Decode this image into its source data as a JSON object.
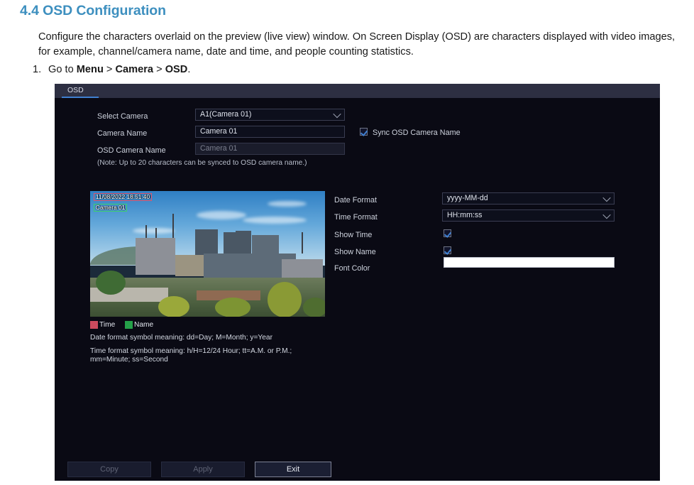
{
  "document": {
    "heading": "4.4 OSD Configuration",
    "paragraph": "Configure the characters overlaid on the preview (live view) window. On Screen Display (OSD) are characters displayed with video images, for example, channel/camera name, date and time, and people counting statistics.",
    "step_number": "1.",
    "step_prefix": "Go to ",
    "step_menu": "Menu",
    "step_sep1": " > ",
    "step_camera": "Camera",
    "step_sep2": " > ",
    "step_osd": "OSD",
    "step_suffix": ".",
    "heading_color": "#3d8fbf"
  },
  "panel": {
    "tab_label": "OSD",
    "accent_color": "#3f7fd0",
    "background_color": "#0a0a14",
    "tabbar_color": "#2d2f42"
  },
  "form": {
    "select_camera": {
      "label": "Select Camera",
      "value": "A1(Camera 01)",
      "icon": "chevron-down-icon"
    },
    "camera_name": {
      "label": "Camera Name",
      "value": "Camera 01"
    },
    "osd_camera_name": {
      "label": "OSD Camera Name",
      "value": "Camera 01",
      "disabled": true
    },
    "note": "(Note: Up to 20 characters can be synced to OSD camera name.)",
    "sync_checkbox": {
      "label": "Sync OSD Camera Name",
      "checked": true
    }
  },
  "settings": {
    "date_format": {
      "label": "Date Format",
      "value": "yyyy-MM-dd",
      "icon": "chevron-down-icon"
    },
    "time_format": {
      "label": "Time Format",
      "value": "HH:mm:ss",
      "icon": "chevron-down-icon"
    },
    "show_time": {
      "label": "Show Time",
      "checked": true
    },
    "show_name": {
      "label": "Show Name",
      "checked": true
    },
    "font_color": {
      "label": "Font Color",
      "value": "#ffffff"
    }
  },
  "preview": {
    "osd_time_text": "11/08/2022 18:51:40",
    "osd_name_text": "Camera 01",
    "time_box_color": "#e0556a",
    "name_box_color": "#3fd06a"
  },
  "legend": {
    "time_label": "Time",
    "time_color": "#cc4b5e",
    "name_label": "Name",
    "name_color": "#25a049",
    "date_hint": "Date format symbol meaning: dd=Day; M=Month; y=Year",
    "time_hint_line1": "Time format symbol meaning: h/H=12/24 Hour; tt=A.M. or P.M.;",
    "time_hint_line2": "mm=Minute; ss=Second"
  },
  "buttons": {
    "copy": "Copy",
    "apply": "Apply",
    "exit": "Exit"
  }
}
